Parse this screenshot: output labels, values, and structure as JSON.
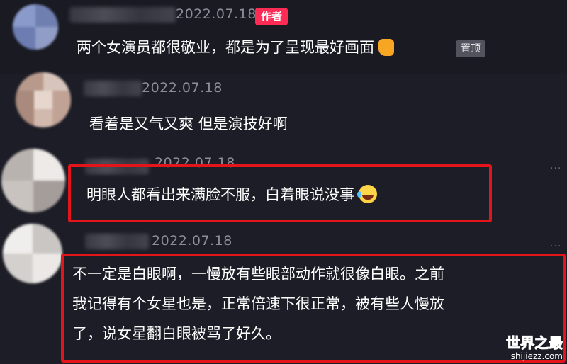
{
  "comments": [
    {
      "date": "2022.07.18",
      "author_badge": "作者",
      "text": "两个女演员都很敬业，都是为了呈现最好画面",
      "emoji": "thumbs-up-icon",
      "pinned_label": "置顶"
    },
    {
      "date": "2022.07.18",
      "text": "看着是又气又爽 但是演技好啊"
    },
    {
      "date": "2022.07.18",
      "text": "明眼人都看出来满脸不服，白着眼说没事",
      "emoji": "laughing-crying-icon"
    },
    {
      "date": "2022.07.18",
      "lines": [
        "不一定是白眼啊，一慢放有些眼部动作就很像白眼。之前",
        "我记得有个女星也是，正常倍速下很正常，被有些人慢放",
        "了，说女星翻白眼被骂了好久。"
      ]
    }
  ],
  "watermark": {
    "title": "世界之最",
    "url": "shijiezz.com"
  },
  "colors": {
    "background": "#1c1d26",
    "author_badge": "#fe2c55",
    "highlight_border": "#e3151b",
    "date_text": "#8c8d96"
  }
}
